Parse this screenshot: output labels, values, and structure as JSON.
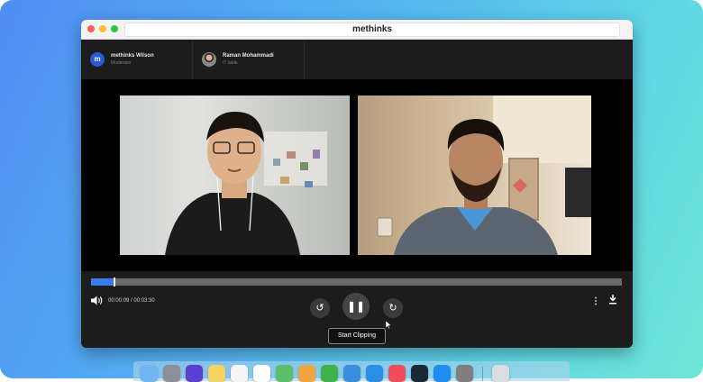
{
  "window": {
    "url": "methinks"
  },
  "participants": [
    {
      "initial": "m",
      "name": "methinks Wilson",
      "role": "Moderator"
    },
    {
      "name": "Raman Mohammadi",
      "role": "IT table"
    }
  ],
  "player": {
    "time": "00:00:09 / 00:03:30",
    "progress_fraction": 0.043,
    "tooltip": "Start Clipping"
  },
  "icons": {
    "volume": "volume-icon",
    "rewind": "rewind-10-icon",
    "pause": "pause-icon",
    "forward": "forward-10-icon",
    "more": "more-vertical-icon",
    "download": "download-icon"
  },
  "colors": {
    "accent": "#3a7bf0",
    "window_bg": "#191919",
    "avatar_bg": "#2b5bd7"
  },
  "dock": [
    {
      "name": "finder-dock-icon",
      "color": "#6fb6f5"
    },
    {
      "name": "launchpad-dock-icon",
      "color": "#8a8f99"
    },
    {
      "name": "siri-dock-icon",
      "color": "#5a3fd1"
    },
    {
      "name": "notes-dock-icon",
      "color": "#f4d35e"
    },
    {
      "name": "reminders-dock-icon",
      "color": "#f5f5f5"
    },
    {
      "name": "calendar-dock-icon",
      "color": "#ffffff"
    },
    {
      "name": "maps-dock-icon",
      "color": "#5bbf6a"
    },
    {
      "name": "photos-dock-icon",
      "color": "#f0a640"
    },
    {
      "name": "numbers-dock-icon",
      "color": "#3db14a"
    },
    {
      "name": "keynote-dock-icon",
      "color": "#3b8de0"
    },
    {
      "name": "safari-dock-icon",
      "color": "#2a8ee6"
    },
    {
      "name": "music-dock-icon",
      "color": "#f24b5a"
    },
    {
      "name": "steam-dock-icon",
      "color": "#1b2838"
    },
    {
      "name": "appstore-dock-icon",
      "color": "#1f8cf0"
    },
    {
      "name": "settings-dock-icon",
      "color": "#7f7f7f"
    },
    {
      "name": "trash-dock-icon",
      "color": "#d9dde2"
    }
  ]
}
